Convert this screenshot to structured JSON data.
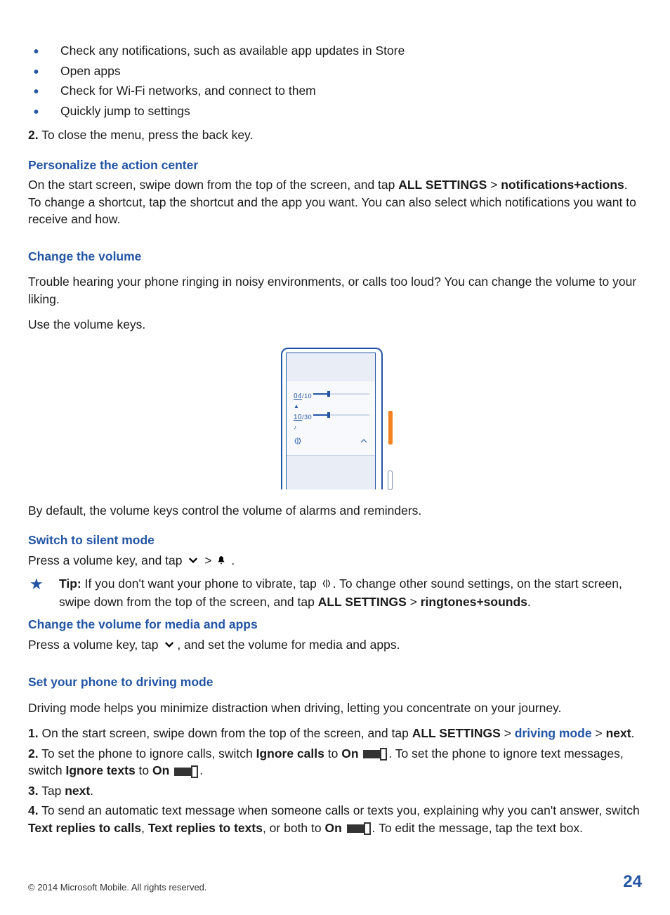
{
  "bullets": [
    "Check any notifications, such as available app updates in Store",
    "Open apps",
    "Check for Wi-Fi networks, and connect to them",
    "Quickly jump to settings"
  ],
  "step2_prefix": "2.",
  "step2_text": " To close the menu, press the back key.",
  "personalize": {
    "heading": "Personalize the action center",
    "p1a": "On the start screen, swipe down from the top of the screen, and tap ",
    "all_settings": "ALL SETTINGS",
    "gt": " > ",
    "notif_actions": "notifications+actions",
    "p1b": ". To change a shortcut, tap the shortcut and the app you want. You can also select which notifications you want to receive and how."
  },
  "volume": {
    "heading": "Change the volume",
    "p1": "Trouble hearing your phone ringing in noisy environments, or calls too loud? You can change the volume to your liking.",
    "p2": "Use the volume keys.",
    "default": "By default, the volume keys control the volume of alarms and reminders.",
    "illus": {
      "v1": "04",
      "v1d": "/10",
      "v2": "10",
      "v2d": "/30"
    }
  },
  "silent": {
    "heading": "Switch to silent mode",
    "press": "Press a volume key, and tap ",
    "gt": " > ",
    "period": "."
  },
  "tip": {
    "label": "Tip:",
    "t1": " If you don't want your phone to vibrate, tap ",
    "t2": ". To change other sound settings, on the start screen, swipe down from the top of the screen, and tap ",
    "all_settings": "ALL SETTINGS",
    "gt": " > ",
    "ringtones": "ringtones+sounds",
    "period": "."
  },
  "media": {
    "heading": "Change the volume for media and apps",
    "p1a": "Press a volume key, tap ",
    "p1b": ", and set the volume for media and apps."
  },
  "driving": {
    "heading": "Set your phone to driving mode",
    "intro": "Driving mode helps you minimize distraction when driving, letting you concentrate on your journey.",
    "s1n": "1.",
    "s1a": " On the start screen, swipe down from the top of the screen, and tap ",
    "all_settings": "ALL SETTINGS",
    "gt": " > ",
    "driving_mode": "driving mode",
    "next": "next",
    "period": ".",
    "s2n": "2.",
    "s2a": " To set the phone to ignore calls, switch ",
    "ignore_calls": "Ignore calls",
    "to": " to ",
    "on": "On",
    "s2b": ". To set the phone to ignore text messages, switch ",
    "ignore_texts": "Ignore texts",
    "s3n": "3.",
    "s3a": " Tap ",
    "s4n": "4.",
    "s4a": " To send an automatic text message when someone calls or texts you, explaining why you can't answer, switch ",
    "trc": "Text replies to calls",
    "comma": ", ",
    "trt": "Text replies to texts",
    "orboth": ", or both to ",
    "s4b": ". To edit the message, tap the text box."
  },
  "footer": {
    "copyright": "© 2014 Microsoft Mobile. All rights reserved.",
    "page": "24"
  }
}
